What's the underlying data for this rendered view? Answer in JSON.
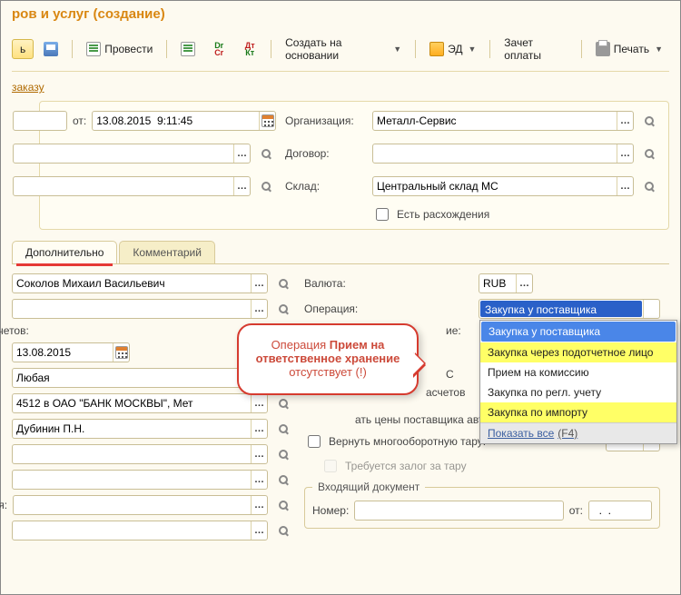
{
  "title": "ров и услуг (создание)",
  "toolbar": {
    "save_close": "ь",
    "provesti": "Провести",
    "drcr": "Dr Cr",
    "dtkt": "Дт Кт",
    "create_base": "Создать на основании",
    "ed": "ЭД",
    "zachet": "Зачет оплаты",
    "print": "Печать"
  },
  "link_order": "заказу",
  "top": {
    "ot_label": "от:",
    "datetime": "13.08.2015  9:11:45",
    "org_label": "Организация:",
    "org_value": "Металл-Сервис",
    "dogovor_label": "Договор:",
    "dogovor_value": "",
    "sklad_label": "Склад:",
    "sklad_value": "Центральный склад МС",
    "rashod_label": "Есть расхождения"
  },
  "tabs": {
    "additional": "Дополнительно",
    "comment": "Комментарий"
  },
  "left": {
    "manager": "Соколов Михаил Васильевич",
    "empty1": "",
    "raschetov": "асчетов:",
    "date": "13.08.2015",
    "lyubaya": "Любая",
    "bank": "4512 в ОАО \"БАНК МОСКВЫ\", Мет",
    "dubinin": "Дубинин П.Н.",
    "empty2": "",
    "empty3": "",
    "elya": "еля:",
    "empty4": "",
    "empty5": ""
  },
  "right": {
    "valuta_label": "Валюта:",
    "valuta_value": "RUB",
    "oper_label": "Операция:",
    "oper_selected": "Закупка у поставщика",
    "ie_suffix": "ие:",
    "c_suffix": "C",
    "raschetov_suffix": "асчетов",
    "auto_prices_suffix": "ать цены поставщика автоматически",
    "tara_return": "Вернуть многооборотную тару:",
    "zalog": "Требуется залог за тару",
    "grp_title": "Входящий документ",
    "nomer_label": "Номер:",
    "nomer_value": "",
    "doc_ot_label": "от:",
    "doc_ot_value": "  .  ."
  },
  "dropdown": {
    "o1": "Закупка у поставщика",
    "o2": "Закупка через подотчетное лицо",
    "o3": "Прием на комиссию",
    "o4": "Закупка по регл. учету",
    "o5": "Закупка по импорту",
    "show_all": "Показать все",
    "show_all_key": "(F4)"
  },
  "callout": {
    "l1": "Операция ",
    "b1": "Прием на ответственное хранение",
    "l2": " ",
    "b2": "отсутствует (!)",
    "l3": ""
  }
}
